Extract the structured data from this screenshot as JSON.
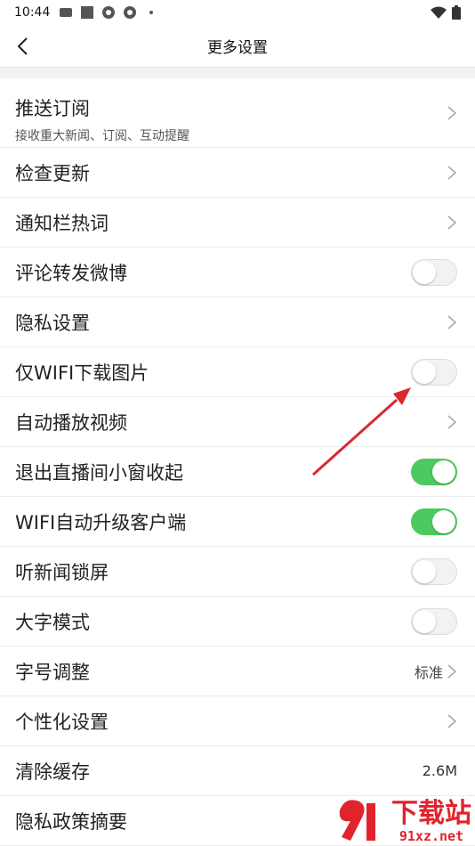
{
  "status_bar": {
    "time": "10:44"
  },
  "header": {
    "title": "更多设置"
  },
  "rows": [
    {
      "title": "推送订阅",
      "subtitle": "接收重大新闻、订阅、互动提醒",
      "control": "chevron"
    },
    {
      "title": "检查更新",
      "control": "chevron"
    },
    {
      "title": "通知栏热词",
      "control": "chevron"
    },
    {
      "title": "评论转发微博",
      "control": "toggle",
      "on": false
    },
    {
      "title": "隐私设置",
      "control": "chevron"
    },
    {
      "title": "仅WIFI下载图片",
      "control": "toggle",
      "on": false
    },
    {
      "title": "自动播放视频",
      "control": "chevron"
    },
    {
      "title": "退出直播间小窗收起",
      "control": "toggle",
      "on": true
    },
    {
      "title": "WIFI自动升级客户端",
      "control": "toggle",
      "on": true
    },
    {
      "title": "听新闻锁屏",
      "control": "toggle",
      "on": false
    },
    {
      "title": "大字模式",
      "control": "toggle",
      "on": false
    },
    {
      "title": "字号调整",
      "control": "value-chevron",
      "value": "标准"
    },
    {
      "title": "个性化设置",
      "control": "chevron"
    },
    {
      "title": "清除缓存",
      "control": "value",
      "value": "2.6M"
    },
    {
      "title": "隐私政策摘要",
      "control": "none"
    }
  ],
  "watermark": {
    "text": "下载站",
    "domain": "91xz.net"
  },
  "colors": {
    "toggle_on": "#4cc95f",
    "annotation_arrow": "#d8282e"
  }
}
